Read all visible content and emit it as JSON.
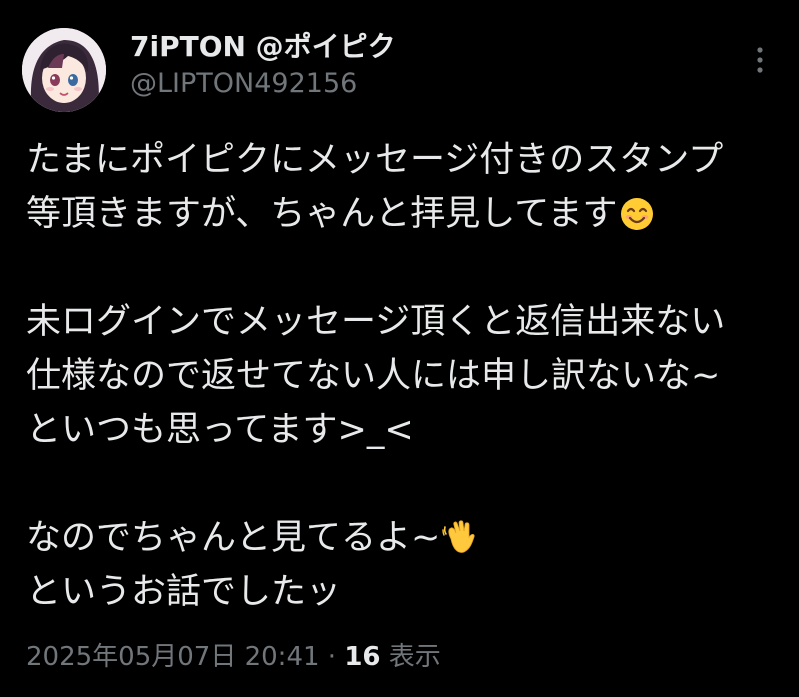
{
  "author": {
    "display_name": "7iPTON @ポイピク",
    "handle": "@LIPTON492156"
  },
  "tweet": {
    "lines": [
      "たまにポイピクにメッセージ付きのスタンプ",
      "等頂きますが、ちゃんと拝見してます",
      "",
      "未ログインでメッセージ頂くと返信出来ない",
      "仕様なので返せてない人には申し訳ないな~",
      "といつも思ってます>_<",
      "",
      "なのでちゃんと見てるよ~",
      "というお話でしたッ"
    ],
    "emoji_smile": "smiling-face-emoji",
    "emoji_wave": "waving-hand-emoji"
  },
  "meta": {
    "timestamp": "2025年05月07日 20:41",
    "separator": " · ",
    "views_count": "16",
    "views_label": " 表示"
  },
  "colors": {
    "background": "#000000",
    "text_primary": "#e7e9ea",
    "text_secondary": "#71767b"
  }
}
